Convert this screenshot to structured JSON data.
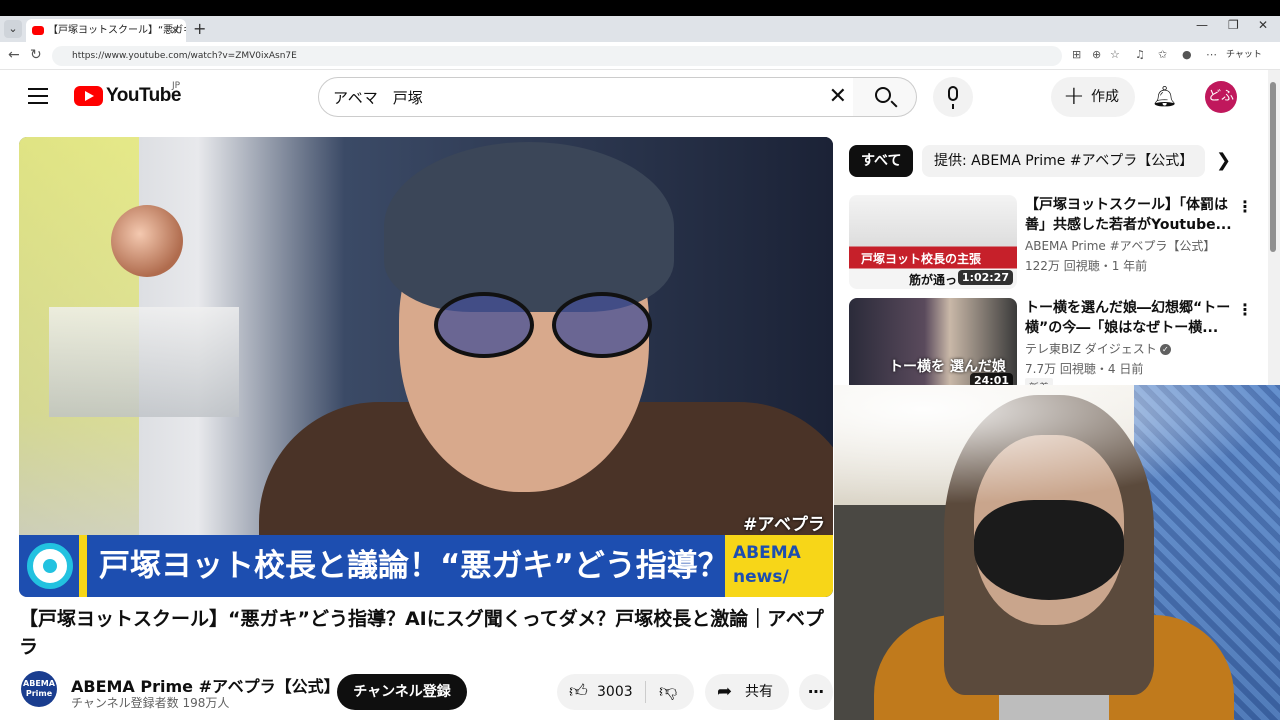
{
  "browser": {
    "tab_title": "【戸塚ヨットスクール】“悪ガキ”どう指",
    "url": "https://www.youtube.com/watch?v=ZMV0ixAsn7E",
    "chat_label": "チャット",
    "new_tab_symbol": "+"
  },
  "header": {
    "logo_text": "YouTube",
    "logo_region": "JP",
    "search_value": "アベマ　戸塚",
    "create_label": "作成",
    "avatar_text": "どふ"
  },
  "player": {
    "watermark": "#アベプラ",
    "caption_text": "戸塚ヨット校長と議論！“悪ガキ”どう指導？",
    "caption_logo_line1": "ABEMA",
    "caption_logo_line2": "news/"
  },
  "video": {
    "title": "【戸塚ヨットスクール】“悪ガキ”どう指導？AIにスグ聞くってダメ？戸塚校長と激論｜アベプラ",
    "channel_name": "ABEMA Prime #アベプラ【公式】",
    "channel_avatar_text": "ABEMA Prime",
    "subscribers": "チャンネル登録者数 198万人",
    "subscribe_label": "チャンネル登録",
    "like_count": "3003",
    "share_label": "共有"
  },
  "chips": {
    "all": "すべて",
    "provided": "提供: ABEMA Prime #アベプラ【公式】"
  },
  "recommendations": [
    {
      "title": "【戸塚ヨットスクール】「体罰は善」共感した若者がYoutube...",
      "channel": "ABEMA Prime #アベプラ【公式】",
      "meta": "122万 回視聴・1 年前",
      "duration": "1:02:27",
      "thumb_text": "戸塚ヨット校長の主張",
      "thumb_sub": "筋が通っ"
    },
    {
      "title": "トー横を選んだ娘―幻想郷“トー横”の今―「娘はなぜトー横...",
      "channel": "テレ東BIZ ダイジェスト",
      "meta": "7.7万 回視聴・4 日前",
      "duration": "24:01",
      "thumb_text": "トー横を 選んだ娘",
      "badge": "新着"
    }
  ],
  "colors": {
    "youtube_red": "#ff0000",
    "caption_blue": "#1d4eb0",
    "caption_yellow": "#f7d618",
    "avatar_bg": "#c0185c"
  }
}
